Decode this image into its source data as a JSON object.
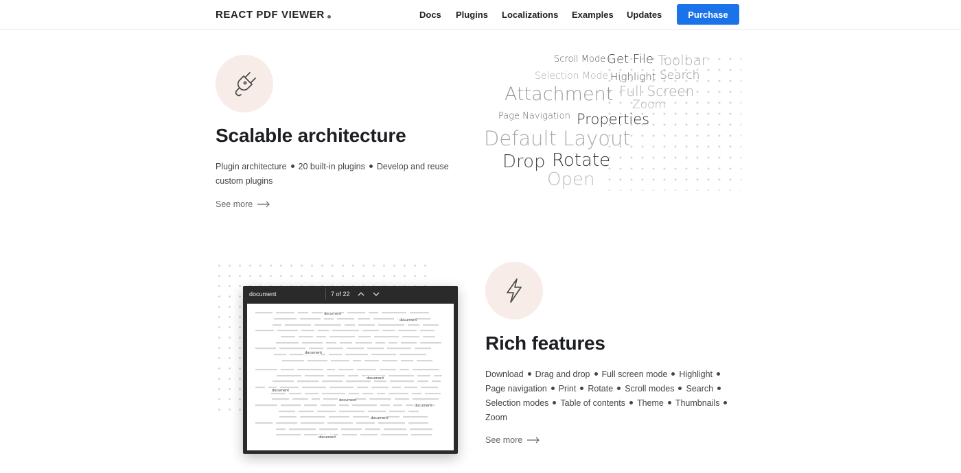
{
  "header": {
    "brand": "REACT PDF VIEWER",
    "nav": [
      "Docs",
      "Plugins",
      "Localizations",
      "Examples",
      "Updates"
    ],
    "purchase_label": "Purchase",
    "purchase_color": "#1a73e8"
  },
  "scalable": {
    "icon": "plug-icon",
    "title": "Scalable architecture",
    "items": [
      "Plugin architecture",
      "20 built-in plugins",
      "Develop and reuse custom plugins"
    ],
    "see_more": "See more"
  },
  "word_cloud": {
    "words": [
      "Scroll Mode",
      "Get File",
      "Toolbar",
      "Selection Mode",
      "Highlight",
      "Search",
      "Attachment",
      "Full Screen",
      "Zoom",
      "Page Navigation",
      "Properties",
      "Default Layout",
      "Drop",
      "Rotate",
      "Open"
    ]
  },
  "viewer_mock": {
    "document_name": "document",
    "page_indicator": "7 of 22",
    "highlight_word": "document"
  },
  "rich": {
    "icon": "lightning-icon",
    "title": "Rich features",
    "items": [
      "Download",
      "Drag and drop",
      "Full screen mode",
      "Highlight",
      "Page navigation",
      "Print",
      "Rotate",
      "Scroll modes",
      "Search",
      "Selection modes",
      "Table of contents",
      "Theme",
      "Thumbnails",
      "Zoom"
    ],
    "see_more": "See more"
  },
  "colors": {
    "icon_circle": "#f7ece8",
    "accent_blue": "#1a73e8"
  }
}
